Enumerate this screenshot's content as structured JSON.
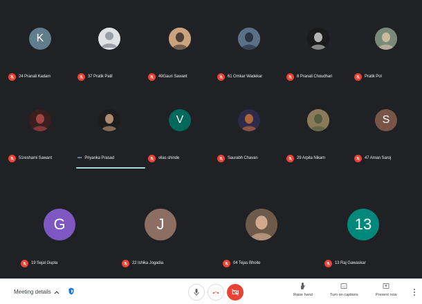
{
  "participants": [
    {
      "name": "24 Pranali Kadam",
      "avatar": {
        "type": "letter",
        "letter": "K",
        "bg": "#607d8b"
      }
    },
    {
      "name": "37 Pratik Patil",
      "avatar": {
        "type": "default",
        "bg": "#dfe1e5"
      }
    },
    {
      "name": "49Gauri Sawant",
      "avatar": {
        "type": "photo",
        "bg": "#c9a27e",
        "accent": "#3a2e2a"
      }
    },
    {
      "name": "61 Omkar Wadekar",
      "avatar": {
        "type": "photo",
        "bg": "#5b6f86",
        "accent": "#1f2a38"
      }
    },
    {
      "name": "8 Pranali Choudhari",
      "avatar": {
        "type": "photo",
        "bg": "#1b1b1b",
        "accent": "#cfcfcf"
      }
    },
    {
      "name": "Pratik Pol",
      "avatar": {
        "type": "photo",
        "bg": "#7a8a7a",
        "accent": "#d8c3a5"
      }
    },
    {
      "name": "51reshami Sawant",
      "avatar": {
        "type": "photo",
        "bg": "#3a1f1f",
        "accent": "#b24a4a"
      }
    },
    {
      "name": "Priyanka Prasad",
      "speaking": true,
      "avatar": {
        "type": "photo",
        "bg": "#1d1d1d",
        "accent": "#c8a080"
      }
    },
    {
      "name": "vilas shinde",
      "avatar": {
        "type": "letter",
        "letter": "V",
        "bg": "#00695c"
      }
    },
    {
      "name": "Saurabh Chavan",
      "avatar": {
        "type": "photo",
        "bg": "#2d2a4a",
        "accent": "#c46f3a"
      }
    },
    {
      "name": "29 Arpita Nikam",
      "avatar": {
        "type": "photo",
        "bg": "#8a7a5a",
        "accent": "#4a5a3a"
      }
    },
    {
      "name": "47 Aman Saroj",
      "avatar": {
        "type": "letter",
        "letter": "S",
        "bg": "#795548"
      }
    },
    {
      "name": "19 Sejal Gupta",
      "avatar": {
        "type": "letter",
        "letter": "G",
        "bg": "#7e57c2"
      }
    },
    {
      "name": "22 Ishika Jogadia",
      "avatar": {
        "type": "letter",
        "letter": "J",
        "bg": "#8d6e63"
      }
    },
    {
      "name": "04 Tejas Bhoite",
      "avatar": {
        "type": "photo",
        "bg": "#6e5a4a",
        "accent": "#e0b89a"
      }
    },
    {
      "name": "13 Raj Gawaskar",
      "avatar": {
        "type": "letter",
        "letter": "13",
        "bg": "#00897b"
      }
    }
  ],
  "bottombar": {
    "meeting_details_label": "Meeting details",
    "raise_hand_label": "Raise hand",
    "captions_label": "Turn on captions",
    "present_label": "Present now"
  },
  "colors": {
    "background": "#202124",
    "mic_off": "#ea4335",
    "end_call": "#ea4335",
    "speaking": "#a8dadc"
  },
  "icons": {
    "meeting_details": "chevron-up-icon",
    "security": "shield-icon",
    "mic": "mic-icon",
    "hangup": "hangup-icon",
    "camera": "camera-off-icon",
    "raise_hand": "hand-icon",
    "captions": "captions-icon",
    "present": "present-icon",
    "more": "more-vertical-icon"
  }
}
